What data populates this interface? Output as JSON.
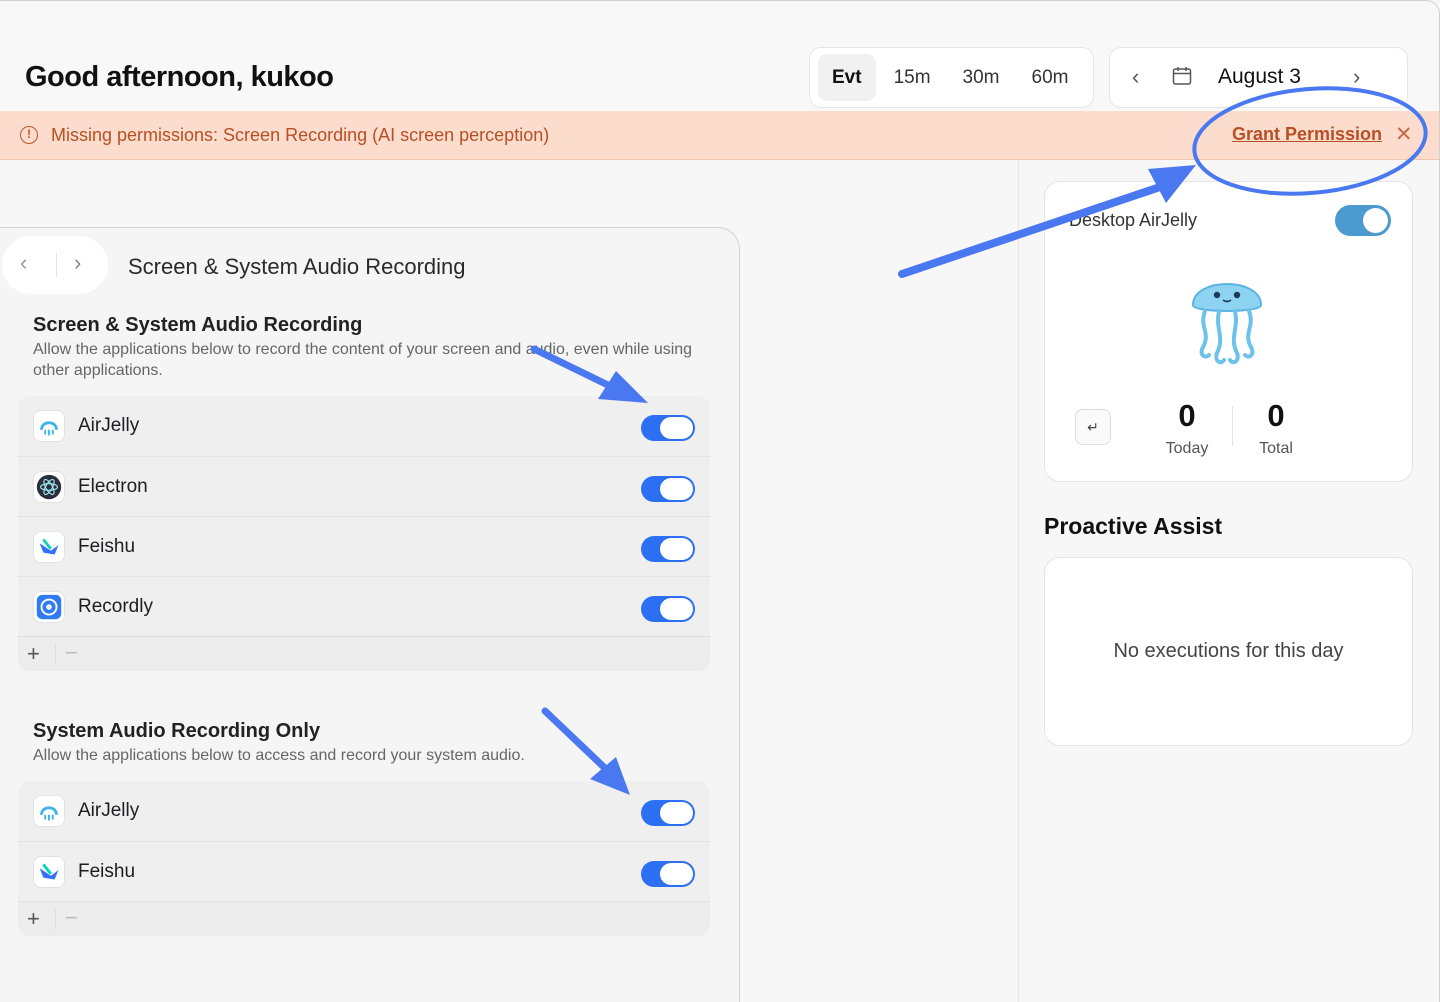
{
  "header": {
    "greeting": "Good afternoon, kukoo",
    "range_tabs": [
      "Evt",
      "15m",
      "30m",
      "60m"
    ],
    "active_tab": "Evt",
    "date_label": "August 3",
    "prev_glyph": "‹",
    "next_glyph": "›"
  },
  "banner": {
    "icon": "alert-circle-icon",
    "icon_glyph": "!",
    "message": "Missing permissions: Screen Recording (AI screen perception)",
    "action_label": "Grant Permission",
    "close_glyph": "✕",
    "color": "#b94f24",
    "background": "#fcdccc"
  },
  "desktop_card": {
    "title": "Desktop AirJelly",
    "toggle_on": true,
    "enter_glyph": "↵",
    "stats": [
      {
        "value": "0",
        "label": "Today"
      },
      {
        "value": "0",
        "label": "Total"
      }
    ]
  },
  "proactive": {
    "title": "Proactive Assist",
    "empty_message": "No executions for this day"
  },
  "settings": {
    "back_glyph": "‹",
    "forward_glyph": "›",
    "heading": "Screen & System Audio Recording",
    "sections": [
      {
        "title": "Screen & System Audio Recording",
        "description": "Allow the applications below to record the content of your screen and audio, even while using other applications.",
        "apps": [
          {
            "name": "AirJelly",
            "enabled": true
          },
          {
            "name": "Electron",
            "enabled": true
          },
          {
            "name": "Feishu",
            "enabled": true
          },
          {
            "name": "Recordly",
            "enabled": true
          }
        ]
      },
      {
        "title": "System Audio Recording Only",
        "description": "Allow the applications below to access and record your system audio.",
        "apps": [
          {
            "name": "AirJelly",
            "enabled": true
          },
          {
            "name": "Feishu",
            "enabled": true
          }
        ]
      }
    ],
    "add_glyph": "+",
    "remove_glyph": "−",
    "toggle_color": "#2d6ff2"
  },
  "annotation_color": "#4a78f0"
}
